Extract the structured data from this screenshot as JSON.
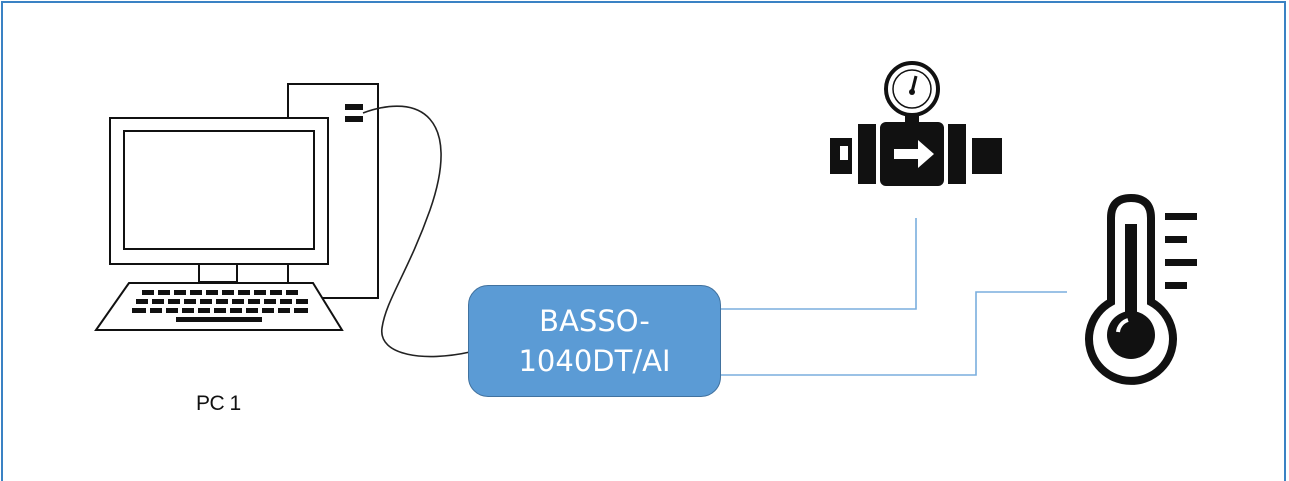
{
  "diagram": {
    "pc": {
      "label": "PC 1",
      "icon": "desktop-computer-icon"
    },
    "device": {
      "line1": "BASSO-",
      "line2": "1040DT/AI",
      "fill_color": "#5b9bd5"
    },
    "sensors": [
      {
        "icon": "flow-meter-icon"
      },
      {
        "icon": "thermometer-icon"
      }
    ],
    "colors": {
      "frame": "#3a82c4",
      "connector_line": "#7aaede",
      "cable": "#222222"
    }
  }
}
